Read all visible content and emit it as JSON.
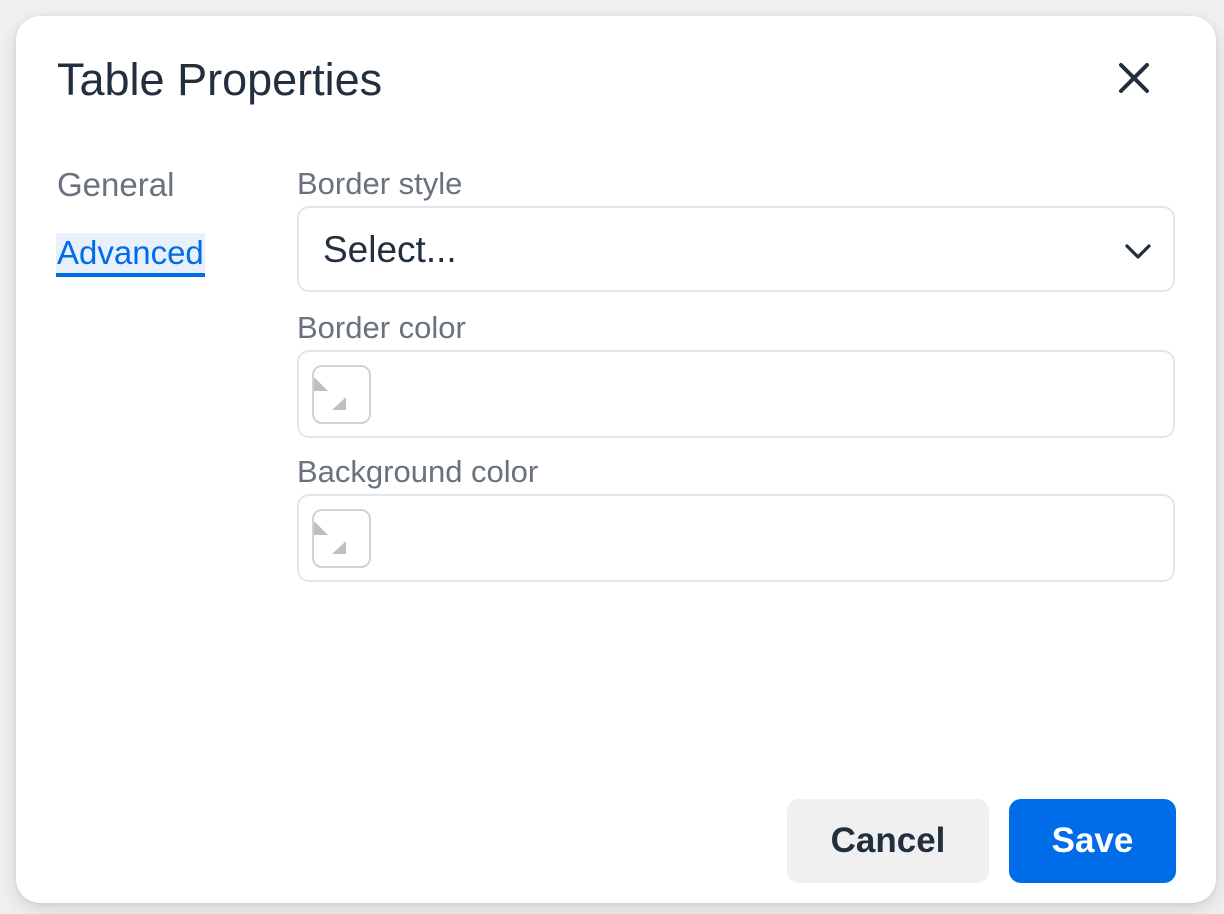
{
  "dialog": {
    "title": "Table Properties",
    "close_icon": "close-icon"
  },
  "tabs": [
    {
      "label": "General",
      "active": false
    },
    {
      "label": "Advanced",
      "active": true
    }
  ],
  "fields": {
    "border_style": {
      "label": "Border style",
      "value": "Select..."
    },
    "border_color": {
      "label": "Border color",
      "value": ""
    },
    "background_color": {
      "label": "Background color",
      "value": ""
    }
  },
  "footer": {
    "cancel_label": "Cancel",
    "save_label": "Save"
  },
  "colors": {
    "accent": "#006ce7",
    "text": "#222f3e",
    "muted": "#6a737d",
    "border": "#e3e6e9"
  }
}
